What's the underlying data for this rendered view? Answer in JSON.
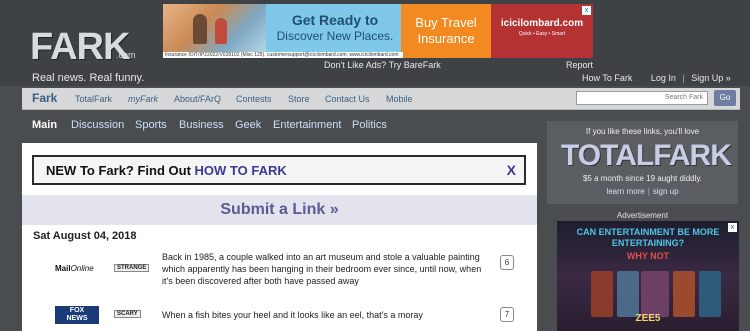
{
  "header": {
    "logo_text": "FARK",
    "logo_suffix": ".com",
    "tagline": "Real news. Real funny.",
    "dont_like_ads": "Don't Like Ads? Try BareFark",
    "report": "Report",
    "user_links": [
      "How To Fark",
      "Log In",
      "Sign Up »"
    ]
  },
  "top_ad": {
    "headline": "Get Ready to",
    "headline2": "Discover New Places.",
    "cta": "Buy Travel Insurance",
    "brand": "icicilombard.com",
    "brand_tag": "Quick • Easy • Smart",
    "fine_print": "Insurance IOIT/IP22022/V028102 (Misc 125). customersupport@icicilombard.com, www.icicilombard.com",
    "close": "x"
  },
  "navbar": {
    "fark": "Fark",
    "items": [
      "TotalFark",
      "myFark",
      "About/FArQ",
      "Contests",
      "Store",
      "Contact Us",
      "Mobile"
    ],
    "search_placeholder": "Search Fark",
    "go": "Go"
  },
  "tabs": [
    "Main",
    "Discussion",
    "Sports",
    "Business",
    "Geek",
    "Entertainment",
    "Politics"
  ],
  "main": {
    "new_prefix": "NEW To Fark? Find Out ",
    "new_link": "HOW TO FARK",
    "new_close": "X",
    "submit": "Submit a Link »",
    "date": "Sat August 04, 2018",
    "stories": [
      {
        "source_a": "Mail",
        "source_b": "Online",
        "tag": "STRANGE",
        "text": "Back in 1985, a couple walked into an art museum and stole a valuable painting which apparently has been hanging in their bedroom ever since, until now, when it's been discovered after both have passed away",
        "comments": "6"
      },
      {
        "source_a": "FOX",
        "source_b": "NEWS",
        "tag": "SCARY",
        "text": "When a fish bites your heel and it looks like an eel, that's a moray",
        "comments": "7"
      }
    ]
  },
  "sidebar": {
    "promo_intro": "If you like these links, you'll love",
    "totalfark": "TOTALFARK",
    "promo_price": "$5 a month since 19 aught diddly.",
    "learn_more": "learn more",
    "sign_up": "sign up",
    "ad_label": "Advertisement",
    "side_ad_title": "CAN ENTERTAINMENT BE MORE ENTERTAINING?",
    "side_ad_sub": "WHY NOT",
    "side_ad_logo": "ZEE5",
    "side_ad_close": "x"
  }
}
